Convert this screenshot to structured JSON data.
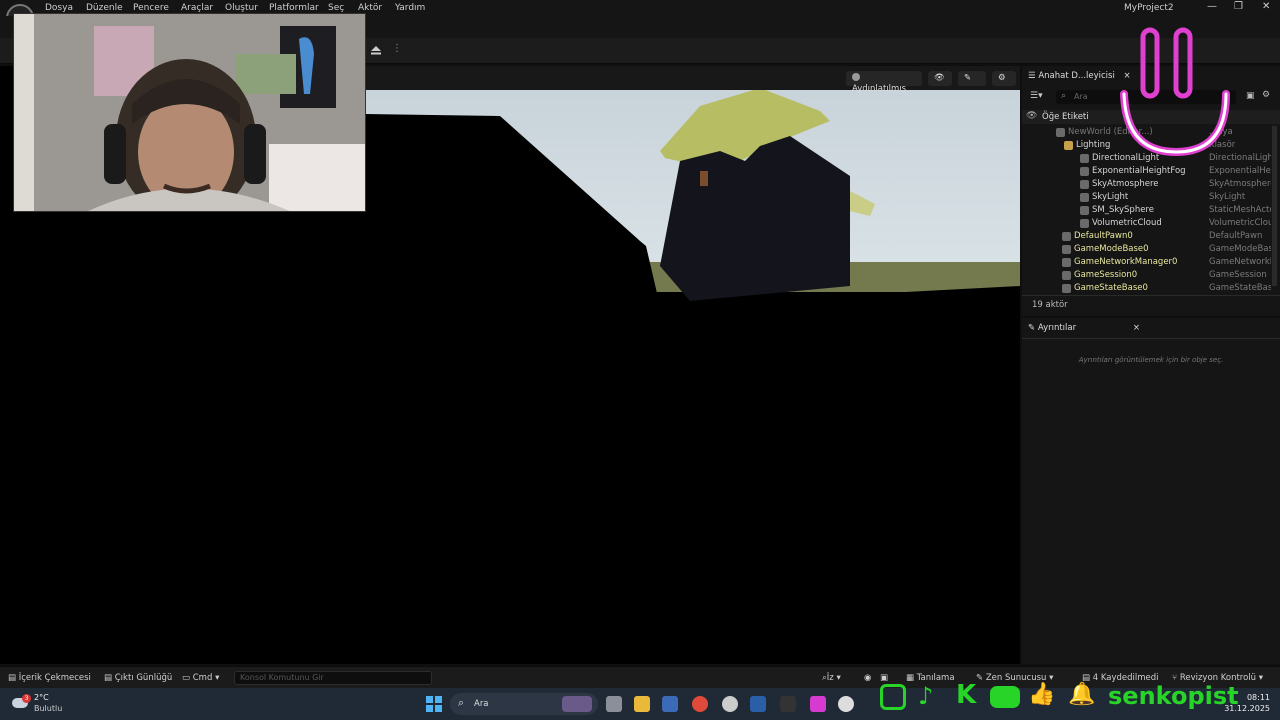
{
  "menubar": {
    "items": [
      "Dosya",
      "Düzenle",
      "Pencere",
      "Araçlar",
      "Oluştur",
      "Platformlar",
      "Seç",
      "Aktör",
      "Yardım"
    ],
    "project_name": "MyProject2",
    "window_controls": [
      "—",
      "❐",
      "✕"
    ]
  },
  "viewport": {
    "lighting_mode": "Aydınlatılmış"
  },
  "outliner": {
    "tab_title": "Anahat D...leyicisi",
    "search_placeholder": "Ara",
    "column_label": "Öğe Etiketi",
    "rows": [
      {
        "label": "NewWorld (Editor...)",
        "type": "...nya",
        "indent": 46,
        "dim": true
      },
      {
        "label": "Lighting",
        "type": "Klasör",
        "indent": 54,
        "folder": true
      },
      {
        "label": "DirectionalLight",
        "type": "DirectionalLight",
        "indent": 70
      },
      {
        "label": "ExponentialHeightFog",
        "type": "ExponentialHeig",
        "indent": 70
      },
      {
        "label": "SkyAtmosphere",
        "type": "SkyAtmosphere",
        "indent": 70
      },
      {
        "label": "SkyLight",
        "type": "SkyLight",
        "indent": 70
      },
      {
        "label": "SM_SkySphere",
        "type": "StaticMeshActo",
        "indent": 70
      },
      {
        "label": "VolumetricCloud",
        "type": "VolumetricCloud",
        "indent": 70
      },
      {
        "label": "DefaultPawn0",
        "type": "DefaultPawn",
        "indent": 52,
        "yellow": true
      },
      {
        "label": "GameModeBase0",
        "type": "GameModeBase",
        "indent": 52,
        "yellow": true
      },
      {
        "label": "GameNetworkManager0",
        "type": "GameNetworkM",
        "indent": 52,
        "yellow": true
      },
      {
        "label": "GameSession0",
        "type": "GameSession",
        "indent": 52,
        "yellow": true
      },
      {
        "label": "GameStateBase0",
        "type": "GameStateBase",
        "indent": 52,
        "yellow": true
      }
    ],
    "actor_count": "19 aktör"
  },
  "details": {
    "tab_title": "Ayrıntılar",
    "empty_message": "Ayrıntıları görüntülemek için bir obje seç."
  },
  "statusbar": {
    "content_drawer": "İçerik Çekmecesi",
    "output_log": "Çıktı Günlüğü",
    "cmd": "Cmd",
    "console_placeholder": "Konsol Komutunu Gir",
    "trace": "İz",
    "derived_data": "Tanılama",
    "zen": "Zen Sunucusu",
    "unsaved": "4 Kaydedilmedi",
    "revision": "Revizyon Kontrolü"
  },
  "taskbar": {
    "weather_temp": "2°C",
    "weather_desc": "Bulutlu",
    "weather_badge": "3",
    "search_label": "Ara",
    "time": "08:11",
    "date": "31.12.2025"
  },
  "overlay": {
    "brand_name": "senkopist",
    "accent_color": "#28d428",
    "smiley_color": "#e040d0"
  }
}
